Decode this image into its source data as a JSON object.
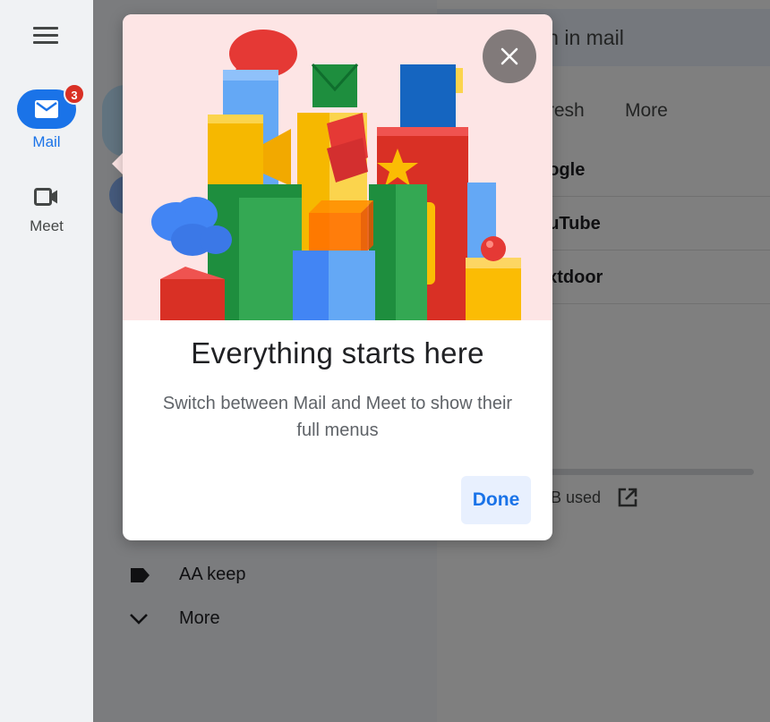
{
  "rail": {
    "menu_icon": "hamburger-menu-icon",
    "mail": {
      "label": "Mail",
      "badge": "3",
      "icon": "mail-icon"
    },
    "meet": {
      "label": "Meet",
      "icon": "video-camera-icon"
    }
  },
  "background": {
    "search_placeholder": "rch in mail",
    "toolbar": {
      "refresh_label": "fresh",
      "more_label": "More"
    },
    "emails": [
      {
        "sender": "oogle"
      },
      {
        "sender": "ouTube"
      },
      {
        "sender": "extdoor"
      }
    ],
    "storage_text": "B used",
    "nav": [
      {
        "label": "AA keep",
        "icon": "label-icon"
      },
      {
        "label": "More",
        "icon": "chevron-down-icon"
      }
    ]
  },
  "dialog": {
    "title": "Everything starts here",
    "body": "Switch between Mail and Meet to show their full menus",
    "done_label": "Done",
    "close_icon": "close-icon"
  },
  "colors": {
    "accent": "#1a73e8",
    "badge": "#d93025",
    "hero_background": "#fde5e5",
    "rail_background": "#f0f2f4"
  }
}
